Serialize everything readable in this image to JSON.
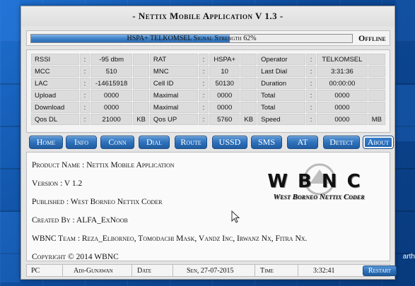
{
  "window": {
    "title": "- Nettix Mobile Application V 1.3 -"
  },
  "signal": {
    "bar_text": "HSPA+ TELKOMSEL Signal Strength 62%",
    "strength_percent": 62,
    "status": "Offline"
  },
  "stats": {
    "rows": [
      [
        {
          "label": "RSSI",
          "value": "-95 dbm",
          "unit": ""
        },
        {
          "label": "RAT",
          "value": "HSPA+",
          "unit": ""
        },
        {
          "label": "Operator",
          "value": "TELKOMSEL",
          "unit": ""
        }
      ],
      [
        {
          "label": "MCC",
          "value": "510",
          "unit": ""
        },
        {
          "label": "MNC",
          "value": "10",
          "unit": ""
        },
        {
          "label": "Last Dial",
          "value": "3:31:36",
          "unit": ""
        }
      ],
      [
        {
          "label": "LAC",
          "value": "-14615918",
          "unit": ""
        },
        {
          "label": "Cell ID",
          "value": "50130",
          "unit": ""
        },
        {
          "label": "Duration",
          "value": "00:00:00",
          "unit": ""
        }
      ],
      [
        {
          "label": "Upload",
          "value": "0000",
          "unit": ""
        },
        {
          "label": "Maximal",
          "value": "0000",
          "unit": ""
        },
        {
          "label": "Total",
          "value": "0000",
          "unit": ""
        }
      ],
      [
        {
          "label": "Download",
          "value": "0000",
          "unit": ""
        },
        {
          "label": "Maximal",
          "value": "0000",
          "unit": ""
        },
        {
          "label": "Total",
          "value": "0000",
          "unit": ""
        }
      ],
      [
        {
          "label": "Qos DL",
          "value": "21000",
          "unit": "KB"
        },
        {
          "label": "Qos UP",
          "value": "5760",
          "unit": "KB"
        },
        {
          "label": "Speed",
          "value": "0000",
          "unit": "MB"
        }
      ]
    ]
  },
  "nav": {
    "active": "About",
    "buttons": [
      "Home",
      "Info",
      "Conn",
      "Dial",
      "Route",
      "USSD",
      "SMS",
      "AT",
      "Detect",
      "About"
    ]
  },
  "about": {
    "product_name": "Product Name : Nettix Mobile Application",
    "version": "Version : V 1.2",
    "published": "Published : West Borneo Nettix Coder",
    "created_by": "Created By : ALFA_ExNoob",
    "team": "WBNC Team : Reza_Elborneo, Tomodachi Mask, Vandz Inc, Irwanz Nx, Fitra Nx.",
    "copyright": "Copyright © 2014 WBNC",
    "logo_letters": "WBNC",
    "logo_subtitle": "West Borneo Nettix Coder"
  },
  "statusbar": {
    "pc_label": "PC",
    "pc_value": "Adi-Gunawan",
    "date_label": "Date",
    "date_value": "Sen, 27-07-2015",
    "time_label": "Time",
    "time_value": "3:32:41",
    "restart_label": "Restart"
  },
  "desktop": {
    "edge_text": "arth"
  },
  "colors": {
    "accent": "#2c6fb8",
    "desktop": "#0f4f9e",
    "panel": "#e4e4e4"
  }
}
